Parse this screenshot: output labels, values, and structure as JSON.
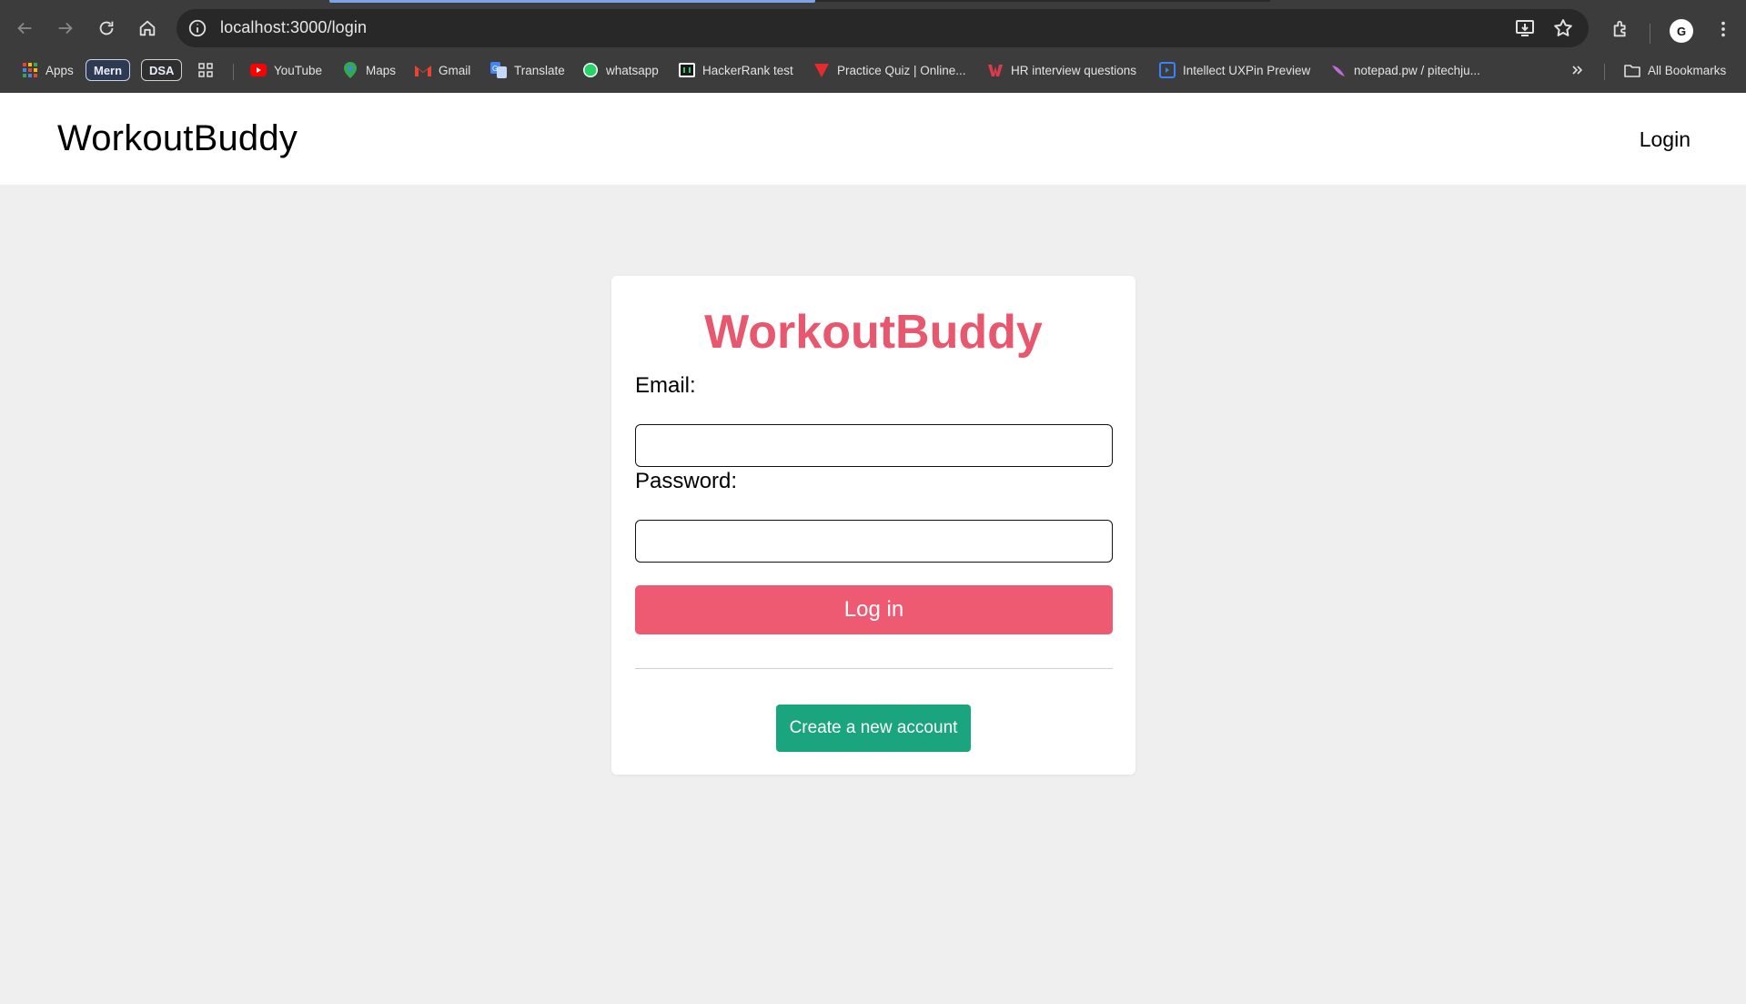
{
  "browser": {
    "url": "localhost:3000/login",
    "bookmarks": [
      {
        "label": "Apps",
        "icon": "apps-grid-icon"
      },
      {
        "label": "Mern",
        "icon": ""
      },
      {
        "label": "DSA",
        "icon": ""
      },
      {
        "label": "YouTube",
        "icon": "youtube-icon"
      },
      {
        "label": "Maps",
        "icon": "maps-pin-icon"
      },
      {
        "label": "Gmail",
        "icon": "gmail-icon"
      },
      {
        "label": "Translate",
        "icon": "translate-icon"
      },
      {
        "label": "whatsapp",
        "icon": "whatsapp-icon"
      },
      {
        "label": "HackerRank test",
        "icon": "hackerrank-icon"
      },
      {
        "label": "Practice Quiz | Online...",
        "icon": "quiz-icon"
      },
      {
        "label": "HR interview questions",
        "icon": "hr-icon"
      },
      {
        "label": "Intellect UXPin Preview",
        "icon": "uxpin-icon"
      },
      {
        "label": "notepad.pw / pitechju...",
        "icon": "notepad-icon"
      }
    ],
    "all_bookmarks": "All Bookmarks",
    "profile_initial": "G"
  },
  "app": {
    "brand": "WorkoutBuddy",
    "nav_login": "Login"
  },
  "login_form": {
    "title": "WorkoutBuddy",
    "email_label": "Email:",
    "email_value": "",
    "password_label": "Password:",
    "password_value": "",
    "submit_label": "Log in",
    "create_account_label": "Create a new account"
  },
  "colors": {
    "brand_pink": "#e7586f",
    "login_button": "#ee5a72",
    "create_button": "#1aa57e",
    "page_background": "#efefef"
  }
}
